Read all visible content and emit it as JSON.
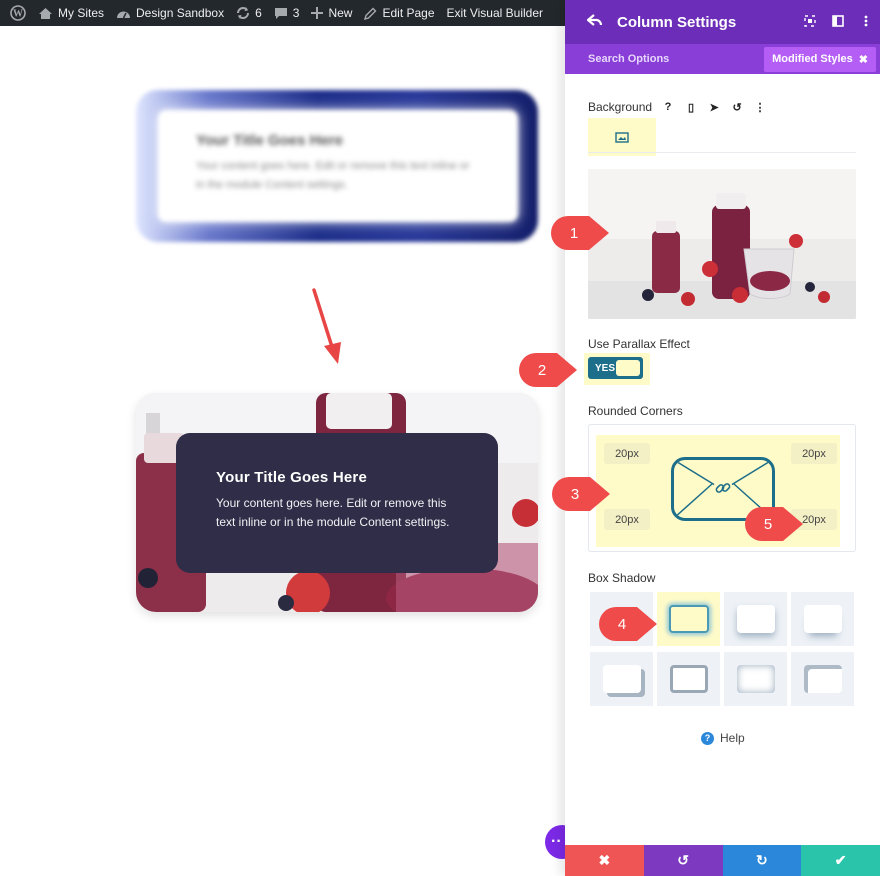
{
  "adminbar": {
    "items": [
      {
        "icon": "wordpress-icon",
        "label": ""
      },
      {
        "icon": "home-icon",
        "label": "My Sites"
      },
      {
        "icon": "dashboard-icon",
        "label": "Design Sandbox"
      },
      {
        "icon": "updates-icon",
        "label": "6"
      },
      {
        "icon": "comment-icon",
        "label": "3"
      },
      {
        "icon": "plus-icon",
        "label": "New"
      },
      {
        "icon": "pencil-icon",
        "label": "Edit Page"
      },
      {
        "icon": "",
        "label": "Exit Visual Builder"
      }
    ]
  },
  "canvas": {
    "blurred_card": {
      "title": "Your Title Goes Here",
      "text": "Your content goes here. Edit or remove this text inline or in the module Content settings."
    },
    "card": {
      "title": "Your Title Goes Here",
      "text": "Your content goes here. Edit or remove this text inline or in the module Content settings."
    },
    "fab_glyph": "··"
  },
  "panel": {
    "title": "Column Settings",
    "search_label": "Search Options",
    "modified_styles_label": "Modified Styles",
    "modified_styles_close": "✖",
    "background_label": "Background",
    "background_icons": [
      "?",
      "▯",
      "➤",
      "↺",
      "⋮"
    ],
    "parallax_label": "Use Parallax Effect",
    "parallax_value": "YES",
    "rounded_corners_label": "Rounded Corners",
    "corners": {
      "top_left": "20px",
      "top_right": "20px",
      "bottom_left": "20px",
      "bottom_right": "20px"
    },
    "box_shadow_label": "Box Shadow",
    "box_shadow_selected_index": 1,
    "help_label": "Help",
    "footer": [
      {
        "glyph": "✖",
        "color": "#ef5555"
      },
      {
        "glyph": "↺",
        "color": "#7d3ac1"
      },
      {
        "glyph": "↻",
        "color": "#2b87da"
      },
      {
        "glyph": "✔",
        "color": "#29c4a9"
      }
    ]
  },
  "callouts": [
    "1",
    "2",
    "3",
    "4",
    "5"
  ],
  "colors": {
    "adminbar_bg": "#23282d",
    "panel_header": "#6c2eb9",
    "panel_subheader": "#8a3ed8",
    "highlight": "#fffbc8",
    "toggle_on": "#1c6e8a",
    "callout_red": "#ef4b4b",
    "card_overlay": "#2f2d47"
  }
}
